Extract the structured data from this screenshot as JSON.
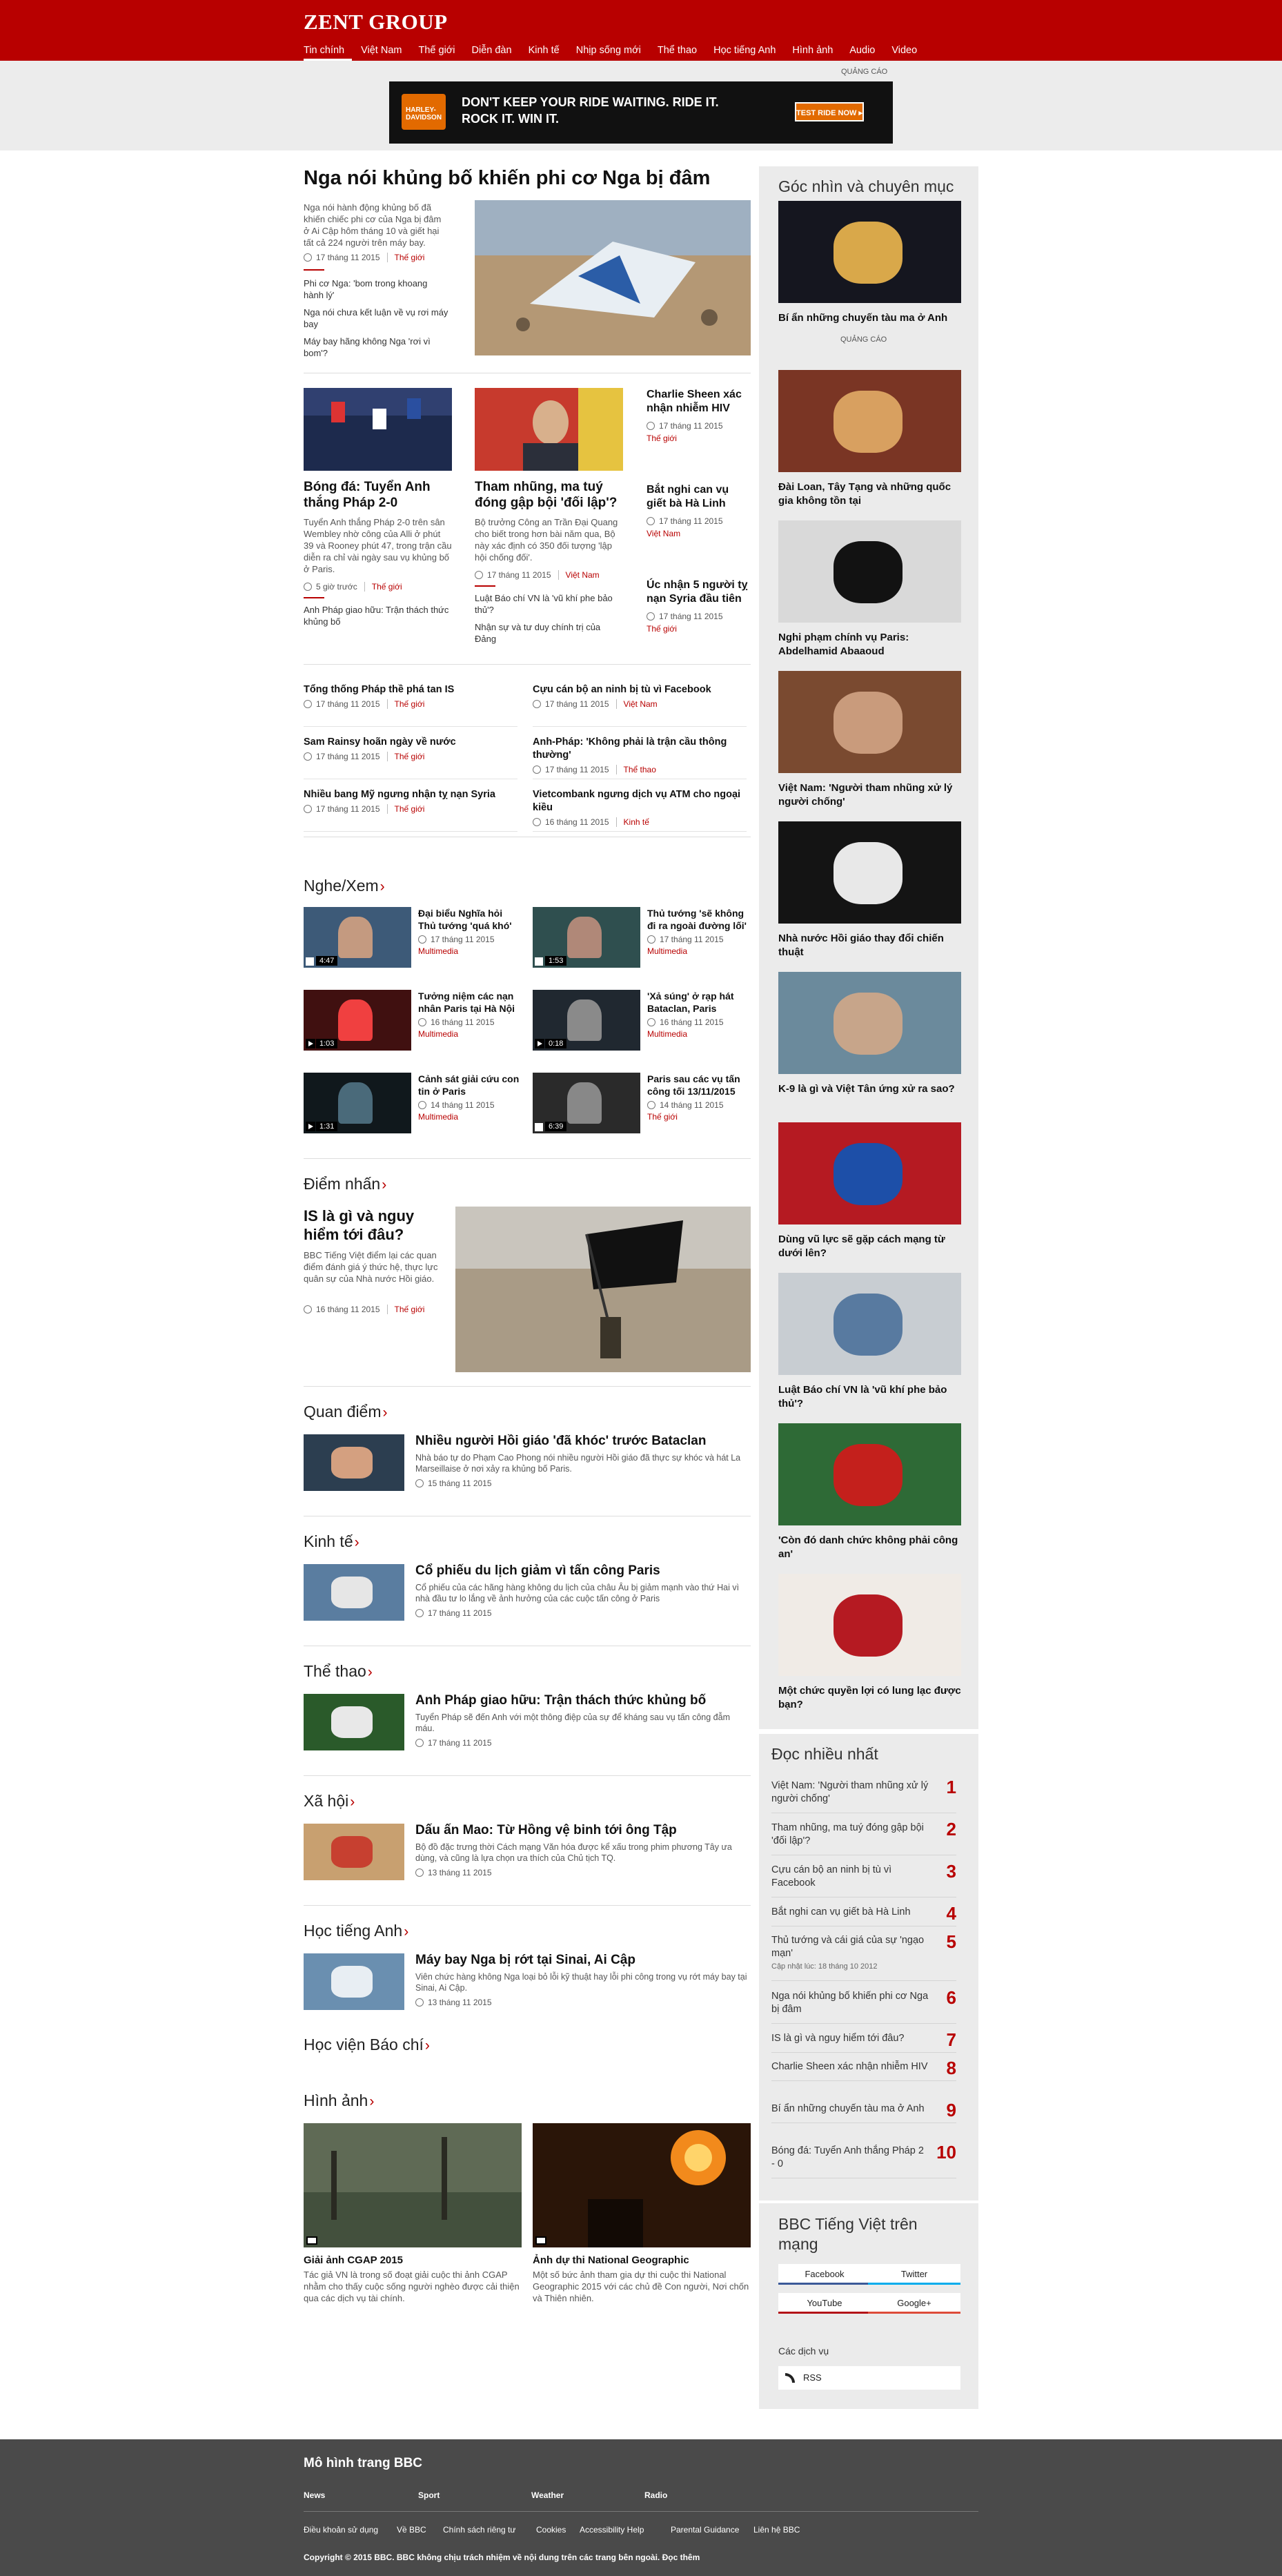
{
  "brand": "ZENT GROUP",
  "nav": [
    "Tin chính",
    "Việt Nam",
    "Thế giới",
    "Diễn đàn",
    "Kinh tế",
    "Nhịp sống mới",
    "Thể thao",
    "Học tiếng Anh",
    "Hình ảnh",
    "Audio",
    "Video"
  ],
  "ad": {
    "label": "QUẢNG CÁO",
    "slogan": "DON'T KEEP YOUR RIDE WAITING. RIDE IT. ROCK IT. WIN IT.",
    "cta": "TEST RIDE NOW ▸",
    "logo": "HARLEY-DAVIDSON"
  },
  "lead": {
    "title": "Nga nói khủng bố khiến phi cơ Nga bị đâm",
    "summary": "Nga nói hành động khủng bố đã khiến chiếc phi cơ của Nga bị đâm ở Ai Cập hôm tháng 10 và giết hại tất cả 224 người trên máy bay.",
    "time": "17 tháng 11 2015",
    "cat": "Thế giới",
    "related": [
      "Phi cơ Nga: 'bom trong khoang hành lý'",
      "Nga nói chưa kết luận về vụ rơi máy bay",
      "Máy bay hãng không Nga 'rơi vì bom'?"
    ]
  },
  "tops": [
    {
      "title": "Bóng đá: Tuyển Anh thắng Pháp 2-0",
      "summary": "Tuyển Anh thắng Pháp 2-0 trên sân Wembley nhờ công của Alli ở phút 39 và Rooney phút 47, trong trận cầu diễn ra chỉ vài ngày sau vụ khủng bố ở Paris.",
      "time": "5 giờ trước",
      "cat": "Thế giới",
      "related": [
        "Anh Pháp giao hữu: Trận thách thức khủng bố"
      ]
    },
    {
      "title": "Tham nhũng, ma tuý đóng gập bội 'đối lập'?",
      "summary": "Bộ trưởng Công an Trần Đại Quang cho biết trong hơn bài năm qua, Bộ này xác định có 350 đối tượng 'lập hội chống đối'.",
      "time": "17 tháng 11 2015",
      "cat": "Việt Nam",
      "related": [
        "Luật Báo chí VN là 'vũ khí phe bảo thủ'?",
        "Nhận sự và tư duy chính trị của Đảng"
      ]
    }
  ],
  "rightcol": [
    {
      "title": "Charlie Sheen xác nhận nhiễm HIV",
      "time": "17 tháng 11 2015",
      "cat": "Thế giới"
    },
    {
      "title": "Bắt nghi can vụ giết bà Hà Linh",
      "time": "17 tháng 11 2015",
      "cat": "Việt Nam"
    },
    {
      "title": "Úc nhận 5 người tỵ nạn Syria đầu tiên",
      "time": "17 tháng 11 2015",
      "cat": "Thế giới"
    }
  ],
  "briefs": [
    {
      "title": "Tổng thống Pháp thề phá tan IS",
      "time": "17 tháng 11 2015",
      "cat": "Thế giới"
    },
    {
      "title": "Cựu cán bộ an ninh bị tù vì Facebook",
      "time": "17 tháng 11 2015",
      "cat": "Việt Nam"
    },
    {
      "title": "Sam Rainsy hoãn ngày về nước",
      "time": "17 tháng 11 2015",
      "cat": "Thế giới"
    },
    {
      "title": "Anh-Pháp: 'Không phải là trận cầu thông thường'",
      "time": "17 tháng 11 2015",
      "cat": "Thể thao"
    },
    {
      "title": "Nhiều bang Mỹ ngưng nhận tỵ nạn Syria",
      "time": "17 tháng 11 2015",
      "cat": "Thế giới"
    },
    {
      "title": "Vietcombank ngưng dịch vụ ATM cho ngoại kiều",
      "time": "16 tháng 11 2015",
      "cat": "Kinh tế"
    }
  ],
  "ngheXem": {
    "title": "Nghe/Xem",
    "items": [
      {
        "title": "Đại biểu Nghĩa hỏi Thủ tướng 'quá khó'",
        "time": "17 tháng 11 2015",
        "cat": "Multimedia",
        "dur": "4:47"
      },
      {
        "title": "Thủ tướng 'sẽ không đi ra ngoài đường lối'",
        "time": "17 tháng 11 2015",
        "cat": "Multimedia",
        "dur": "1:53"
      },
      {
        "title": "Tưởng niệm các nạn nhân Paris tại Hà Nội",
        "time": "16 tháng 11 2015",
        "cat": "Multimedia",
        "dur": "1:03"
      },
      {
        "title": "'Xả súng' ở rạp hát Bataclan, Paris",
        "time": "16 tháng 11 2015",
        "cat": "Multimedia",
        "dur": "0:18"
      },
      {
        "title": "Cảnh sát giải cứu con tin ở Paris",
        "time": "14 tháng 11 2015",
        "cat": "Multimedia",
        "dur": "1:31"
      },
      {
        "title": "Paris sau các vụ tấn công tối 13/11/2015",
        "time": "14 tháng 11 2015",
        "cat": "Thế giới",
        "dur": "6:39"
      }
    ]
  },
  "diemNhan": {
    "section": "Điểm nhấn",
    "title": "IS là gì và nguy hiểm tới đâu?",
    "summary": "BBC Tiếng Việt điểm lại các quan điểm đánh giá ý thức hệ, thực lực quân sự của Nhà nước Hồi giáo.",
    "time": "16 tháng 11 2015",
    "cat": "Thế giới"
  },
  "sections": [
    {
      "section": "Quan điểm",
      "title": "Nhiều người Hồi giáo 'đã khóc' trước Bataclan",
      "summary": "Nhà báo tự do Phạm Cao Phong nói nhiều người Hồi giáo đã thực sự khóc và hát La Marseillaise ở nơi xảy ra khủng bố Paris.",
      "time": "15 tháng 11 2015"
    },
    {
      "section": "Kinh tế",
      "title": "Cổ phiếu du lịch giảm vì tấn công Paris",
      "summary": "Cổ phiếu của các hãng hàng không du lịch của châu Âu bị giảm mạnh vào thứ Hai vì nhà đầu tư lo lắng về ảnh hưởng của các cuộc tấn công ở Paris",
      "time": "17 tháng 11 2015"
    },
    {
      "section": "Thể thao",
      "title": "Anh Pháp giao hữu: Trận thách thức khủng bố",
      "summary": "Tuyển Pháp sẽ đến Anh với một thông điệp của sự để kháng sau vụ tấn công đẫm máu.",
      "time": "17 tháng 11 2015"
    },
    {
      "section": "Xã hội",
      "title": "Dấu ấn Mao: Từ Hồng vệ binh tới ông Tập",
      "summary": "Bộ đồ đặc trưng thời Cách mạng Văn hóa được kể xấu trong phim phương Tây ưa dùng, và cũng là lựa chọn ưa thích của Chủ tịch TQ.",
      "time": "13 tháng 11 2015"
    },
    {
      "section": "Học tiếng Anh",
      "title": "Máy bay Nga bị rớt tại Sinai, Ai Cập",
      "summary": "Viên chức hàng không Nga loại bỏ lỗi kỹ thuật hay lỗi phi công trong vụ rớt máy bay tại Sinai, Ai Cập.",
      "time": "13 tháng 11 2015"
    }
  ],
  "hocVien": "Học viện Báo chí",
  "hinhAnh": {
    "section": "Hình ảnh",
    "items": [
      {
        "title": "Giải ảnh CGAP 2015",
        "summary": "Tác giả VN là trong số đoạt giải cuộc thi ảnh CGAP nhằm cho thấy cuộc sống người nghèo được cải thiện qua các dịch vụ tài chính."
      },
      {
        "title": "Ảnh dự thi National Geographic",
        "summary": "Một số bức ảnh tham gia dự thi cuộc thi National Geographic 2015 với các chủ đề Con người, Nơi chốn và Thiên nhiên."
      }
    ]
  },
  "sidebar": {
    "title": "Góc nhìn và chuyên mục",
    "adLabel": "QUẢNG CÁO",
    "items": [
      "Bí ẩn những chuyến tàu ma ở Anh",
      "Đài Loan, Tây Tạng và những quốc gia không tồn tại",
      "Nghi phạm chính vụ Paris: Abdelhamid Abaaoud",
      "Việt Nam: 'Người tham nhũng xử lý người chống'",
      "Nhà nước Hồi giáo thay đổi chiến thuật",
      "K-9 là gì và Việt Tân ứng xử ra sao?",
      "Dùng vũ lực sẽ gặp cách mạng từ dưới lên?",
      "Luật Báo chí VN là 'vũ khí phe bảo thủ'?",
      "'Còn đó danh chức không phải công an'",
      "Một chức quyền lợi có lung lạc được bạn?"
    ]
  },
  "mostRead": {
    "title": "Đọc nhiều nhất",
    "items": [
      {
        "text": "Việt Nam: 'Người tham nhũng xử lý người chống'",
        "n": "1"
      },
      {
        "text": "Tham nhũng, ma tuý đóng gập bội 'đối lập'?",
        "n": "2"
      },
      {
        "text": "Cựu cán bộ an ninh bị tù vì Facebook",
        "n": "3"
      },
      {
        "text": "Bắt nghi can vụ giết bà Hà Linh",
        "n": "4"
      },
      {
        "text": "Thủ tướng và cái giá của sự 'ngạo mạn'",
        "n": "5",
        "sub": "Cập nhật lúc: 18 tháng 10 2012"
      },
      {
        "text": "Nga nói khủng bố khiến phi cơ Nga bị đâm",
        "n": "6"
      },
      {
        "text": "IS là gì và nguy hiểm tới đâu?",
        "n": "7"
      },
      {
        "text": "Charlie Sheen xác nhận nhiễm HIV",
        "n": "8"
      },
      {
        "text": "Bí ẩn những chuyến tàu ma ở Anh",
        "n": "9"
      },
      {
        "text": "Bóng đá: Tuyển Anh thắng Pháp 2 - 0",
        "n": "10"
      }
    ]
  },
  "social": {
    "title": "BBC Tiếng Việt trên mạng",
    "buttons": [
      "Facebook",
      "Twitter",
      "YouTube",
      "Google+"
    ],
    "colors": [
      "#3b5998",
      "#00aced",
      "#b31217",
      "#dd4b39"
    ],
    "servicesLabel": "Các dịch vụ",
    "rss": "RSS"
  },
  "footer": {
    "title": "Mô hình trang BBC",
    "links": [
      "News",
      "Sport",
      "Weather",
      "Radio"
    ],
    "small": [
      "Điều khoản sử dụng",
      "Về BBC",
      "Chính sách riêng tư",
      "Cookies",
      "Accessibility Help",
      "Parental Guidance",
      "Liên hệ BBC"
    ],
    "copyright": "Copyright © 2015 BBC. BBC không chịu trách nhiệm về nội dung trên các trang bên ngoài. Đọc thêm"
  }
}
